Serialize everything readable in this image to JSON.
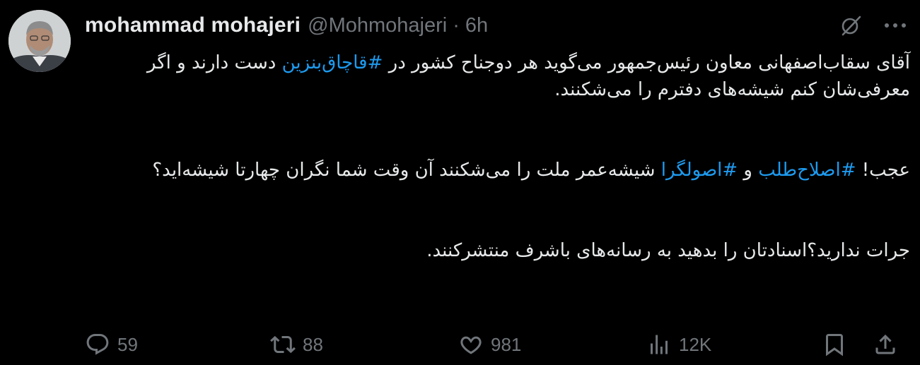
{
  "author": {
    "display_name": "mohammad mohajeri",
    "handle": "@Mohmohajeri",
    "separator": "·",
    "time": "6h"
  },
  "header_icons": [
    "grok-icon",
    "more-icon"
  ],
  "body": {
    "p1_pre": "آقای سقاب‌اصفهانی معاون رئیس‌جمهور می‌گوید هر دوجناح کشور در ",
    "p1_hashtag": "#قاچاق‌بنزین",
    "p1_post": " دست دارند و اگر معرفی‌شان کنم شیشه‌های دفترم را می‌شکنند.",
    "p2_pre": "عجب! ",
    "p2_hashtag1": "#اصلاح‌طلب",
    "p2_mid": " و ",
    "p2_hashtag2": "#اصولگرا",
    "p2_post": " شیشه‌عمر ملت را می‌شکنند آن وقت شما نگران چهارتا شیشه‌اید؟",
    "p3": "جرات ندارید؟اسنادتان را بدهید به رسانه‌های باشرف منتشرکنند."
  },
  "stats": {
    "replies": "59",
    "retweets": "88",
    "likes": "981",
    "views": "12K"
  },
  "colors": {
    "background": "#000000",
    "text": "#e7e9ea",
    "muted": "#71767b",
    "link": "#1d9bf0"
  }
}
